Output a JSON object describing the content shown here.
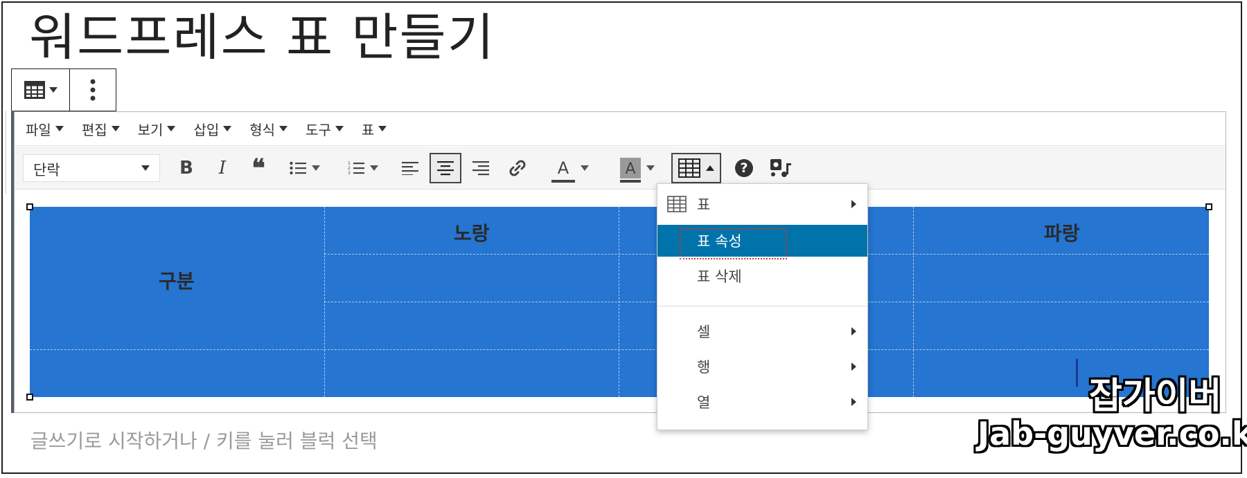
{
  "page_title": "워드프레스 표 만들기",
  "menubar": {
    "items": [
      {
        "label": "파일"
      },
      {
        "label": "편집"
      },
      {
        "label": "보기"
      },
      {
        "label": "삽입"
      },
      {
        "label": "형식"
      },
      {
        "label": "도구"
      },
      {
        "label": "표"
      }
    ]
  },
  "toolbar": {
    "format_select_value": "단락",
    "bold_icon": "B",
    "italic_icon": "I",
    "quote_icon": "❝",
    "text_color_icon": "A",
    "bg_color_icon": "A",
    "help_icon": "?"
  },
  "table": {
    "header_1": "구분",
    "header_2": "노랑",
    "header_4": "파랑",
    "color": "#2575d1"
  },
  "dropdown": {
    "items": [
      {
        "label": "표",
        "submenu": true
      },
      {
        "label": "표 속성",
        "submenu": false,
        "active": true
      },
      {
        "label": "표 삭제",
        "submenu": false
      },
      {
        "label": "셀",
        "submenu": true
      },
      {
        "label": "행",
        "submenu": true
      },
      {
        "label": "열",
        "submenu": true
      }
    ],
    "active_color": "#0073aa"
  },
  "placeholder_text": "글쓰기로 시작하거나 / 키를 눌러 블럭 선택",
  "watermark": {
    "line1": "잡가이버",
    "line2": "Jab-guyver.co.kr"
  }
}
